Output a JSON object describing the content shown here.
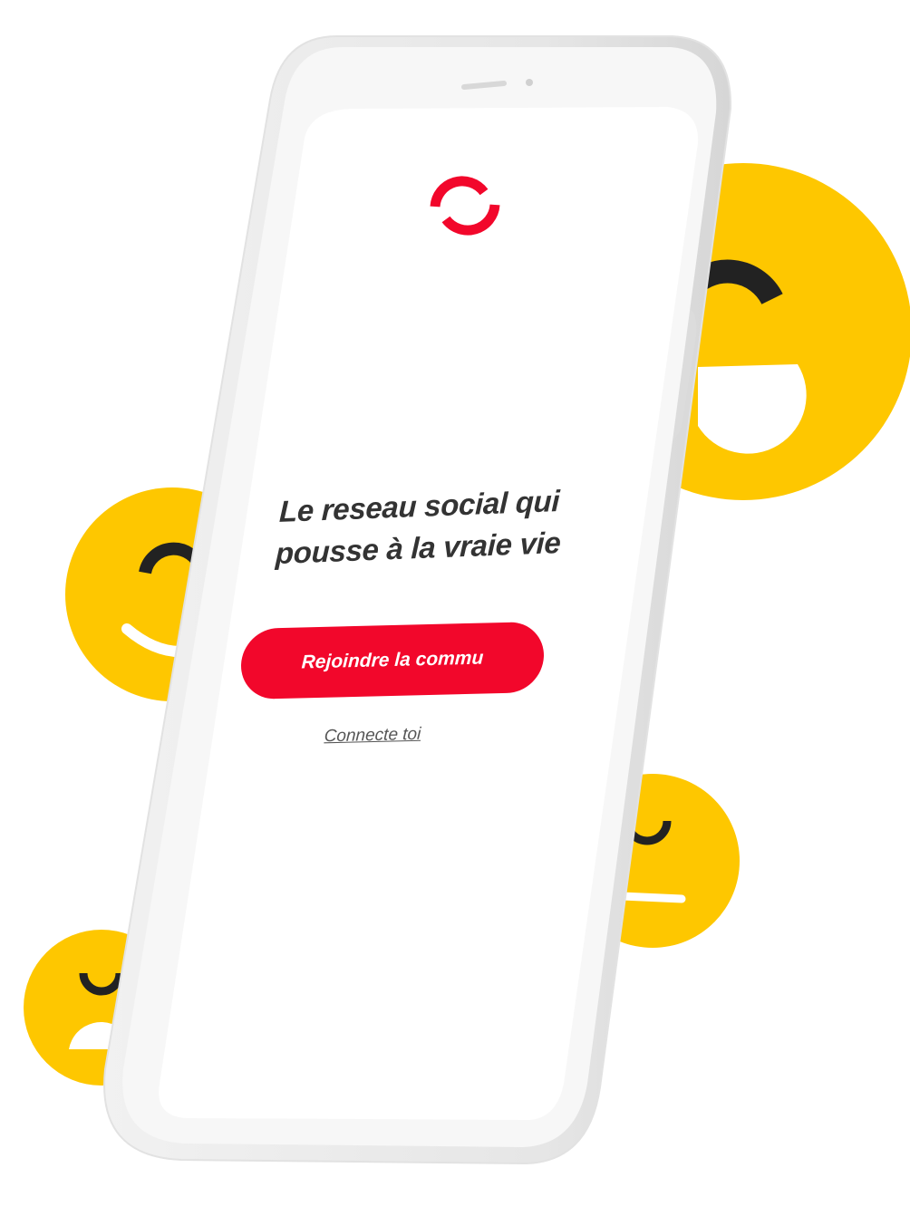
{
  "colors": {
    "brand_red": "#f2072b",
    "emoji_yellow": "#fec700",
    "emoji_features": "#222222",
    "phone_frame": "#e9e9e9",
    "screen_bg": "#ffffff",
    "text_dark": "#333333"
  },
  "app": {
    "logo_icon": "brand-logo-icon",
    "tagline_line1": "Le reseau social qui",
    "tagline_line2": "pousse à la vraie vie",
    "join_button_label": "Rejoindre la commu",
    "login_link_label": "Connecte toi"
  },
  "decor": {
    "emojis": [
      {
        "name": "emoji-large-right-icon"
      },
      {
        "name": "emoji-left-middle-icon"
      },
      {
        "name": "emoji-right-lower-icon"
      },
      {
        "name": "emoji-bottom-left-icon"
      }
    ]
  }
}
